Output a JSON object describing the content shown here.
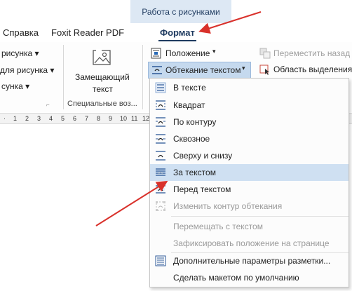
{
  "context_tab": {
    "label": "Работа с рисунками"
  },
  "tabs": {
    "help": "Справка",
    "foxit": "Foxit Reader PDF",
    "format": "Формат"
  },
  "ribbon": {
    "left_items": [
      "рисунка ▾",
      "для рисунка ▾",
      "сунка ▾"
    ],
    "alt_text_line1": "Замещающий",
    "alt_text_line2": "текст",
    "group_special": "Специальные воз...",
    "position": "Положение",
    "wrap_text": "Обтекание текстом",
    "bring_forward": "Переместить назад",
    "selection_pane": "Область выделения"
  },
  "ruler": {
    "ticks": [
      "1",
      "2",
      "3",
      "4",
      "5",
      "6",
      "7",
      "8",
      "9",
      "10",
      "11",
      "12"
    ]
  },
  "menu": {
    "items": [
      {
        "label": "В тексте",
        "icon": "inline-with-text-icon",
        "disabled": false
      },
      {
        "label": "Квадрат",
        "icon": "square-wrap-icon",
        "disabled": false
      },
      {
        "label": "По контуру",
        "icon": "tight-wrap-icon",
        "disabled": false
      },
      {
        "label": "Сквозное",
        "icon": "through-wrap-icon",
        "disabled": false
      },
      {
        "label": "Сверху и снизу",
        "icon": "top-bottom-wrap-icon",
        "disabled": false
      },
      {
        "label": "За текстом",
        "icon": "behind-text-icon",
        "disabled": false,
        "selected": true
      },
      {
        "label": "Перед текстом",
        "icon": "in-front-text-icon",
        "disabled": false
      },
      {
        "label": "Изменить контур обтекания",
        "icon": "edit-wrap-points-icon",
        "disabled": true
      },
      {
        "label": "Перемещать с текстом",
        "disabled": true
      },
      {
        "label": "Зафиксировать положение на странице",
        "disabled": true
      },
      {
        "label": "Дополнительные параметры разметки...",
        "icon": "layout-options-icon",
        "disabled": false
      },
      {
        "label": "Сделать макетом по умолчанию",
        "disabled": false
      }
    ]
  },
  "colors": {
    "accent": "#1e3a5f",
    "selection": "#cfe0f2",
    "arrow": "#d9312b"
  }
}
